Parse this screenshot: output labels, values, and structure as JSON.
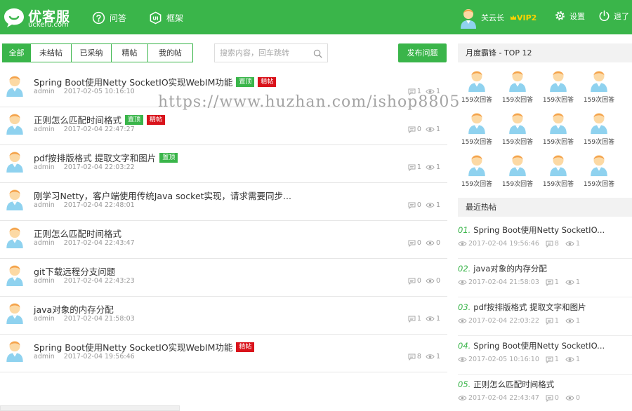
{
  "header": {
    "logo_cn": "优客服",
    "logo_en": "uckefu.com",
    "nav": [
      {
        "label": "问答",
        "icon": "question-icon"
      },
      {
        "label": "框架",
        "icon": "ui-framework-icon"
      }
    ],
    "user_name": "关云长",
    "vip_label": "VIP2",
    "settings_label": "设置",
    "logout_label": "退了",
    "brand_color": "#3ab54a"
  },
  "filters": {
    "tabs": [
      {
        "label": "全部",
        "active": true
      },
      {
        "label": "未结帖",
        "active": false
      },
      {
        "label": "已采纳",
        "active": false
      },
      {
        "label": "精帖",
        "active": false
      },
      {
        "label": "我的帖",
        "active": false
      }
    ],
    "search_placeholder": "搜索内容，回车跳转",
    "post_button": "发布问题"
  },
  "posts": [
    {
      "title": "Spring Boot使用Netty SocketIO实现WebIM功能",
      "badges": [
        "置顶",
        "精帖"
      ],
      "author": "admin",
      "time": "2017-02-05 10:16:10",
      "replies": "1",
      "views": "1"
    },
    {
      "title": "正则怎么匹配时间格式",
      "badges": [
        "置顶",
        "精帖"
      ],
      "author": "admin",
      "time": "2017-02-04 22:47:27",
      "replies": "0",
      "views": "1"
    },
    {
      "title": "pdf按排版格式 提取文字和图片",
      "badges": [
        "置顶"
      ],
      "author": "admin",
      "time": "2017-02-04 22:03:22",
      "replies": "1",
      "views": "1"
    },
    {
      "title": "刚学习Netty，客户端使用传统Java socket实现，请求需要同步...",
      "badges": [],
      "author": "admin",
      "time": "2017-02-04 22:48:01",
      "replies": "0",
      "views": "1"
    },
    {
      "title": "正则怎么匹配时间格式",
      "badges": [],
      "author": "admin",
      "time": "2017-02-04 22:43:47",
      "replies": "0",
      "views": "0"
    },
    {
      "title": "git下载远程分支问题",
      "badges": [],
      "author": "admin",
      "time": "2017-02-04 22:43:23",
      "replies": "0",
      "views": "0"
    },
    {
      "title": "java对象的内存分配",
      "badges": [],
      "author": "admin",
      "time": "2017-02-04 21:58:03",
      "replies": "1",
      "views": "1"
    },
    {
      "title": "Spring Boot使用Netty SocketIO实现WebIM功能",
      "badges": [
        "精帖"
      ],
      "author": "admin",
      "time": "2017-02-04 19:56:46",
      "replies": "8",
      "views": "1"
    }
  ],
  "sidebar": {
    "top_title": "月度霸锋 - TOP 12",
    "top_users": [
      {
        "caption": "159次回答"
      },
      {
        "caption": "159次回答"
      },
      {
        "caption": "159次回答"
      },
      {
        "caption": "159次回答"
      },
      {
        "caption": "159次回答"
      },
      {
        "caption": "159次回答"
      },
      {
        "caption": "159次回答"
      },
      {
        "caption": "159次回答"
      },
      {
        "caption": "159次回答"
      },
      {
        "caption": "159次回答"
      },
      {
        "caption": "159次回答"
      },
      {
        "caption": "159次回答"
      }
    ],
    "hot_title": "最近热帖",
    "hot_posts": [
      {
        "num": "01.",
        "title": "Spring Boot使用Netty SocketIO...",
        "time": "2017-02-04 19:56:46",
        "replies": "8",
        "views": "1"
      },
      {
        "num": "02.",
        "title": "java对象的内存分配",
        "time": "2017-02-04 21:58:03",
        "replies": "1",
        "views": "1"
      },
      {
        "num": "03.",
        "title": "pdf按排版格式 提取文字和图片",
        "time": "2017-02-04 22:03:22",
        "replies": "1",
        "views": "1"
      },
      {
        "num": "04.",
        "title": "Spring Boot使用Netty SocketIO...",
        "time": "2017-02-05 10:16:10",
        "replies": "1",
        "views": "1"
      },
      {
        "num": "05.",
        "title": "正则怎么匹配时间格式",
        "time": "2017-02-04 22:43:47",
        "replies": "0",
        "views": "0"
      }
    ]
  },
  "watermark": "https://www.huzhan.com/ishop8805"
}
